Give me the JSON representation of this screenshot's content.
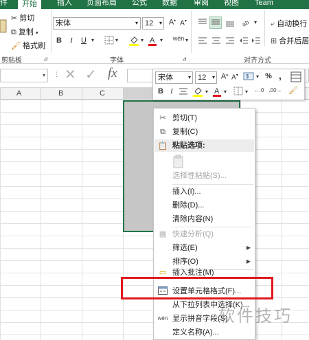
{
  "tabs": [
    {
      "label": "件"
    },
    {
      "label": "开始"
    },
    {
      "label": "插入"
    },
    {
      "label": "页面布局"
    },
    {
      "label": "公式"
    },
    {
      "label": "数据"
    },
    {
      "label": "审阅"
    },
    {
      "label": "视图"
    },
    {
      "label": "Team"
    }
  ],
  "clipboard": {
    "cut": "剪切",
    "copy": "复制",
    "format_painter": "格式刷",
    "group_label": "剪贴板"
  },
  "font": {
    "name": "宋体",
    "size": "12",
    "grow": "A",
    "shrink": "A",
    "bold": "B",
    "italic": "I",
    "underline": "U",
    "group_label": "字体"
  },
  "alignment": {
    "wrap": "自动换行",
    "merge": "合并后居",
    "group_label": "对齐方式"
  },
  "formula_bar": {
    "fx": "fx"
  },
  "columns": [
    "A",
    "B",
    "C"
  ],
  "mini_toolbar": {
    "font": "宋体",
    "size": "12",
    "percent": "%",
    "comma": ","
  },
  "context_menu": {
    "cut": "剪切(T)",
    "copy": "复制(C)",
    "paste_options": "粘贴选项:",
    "paste_special": "选择性粘贴(S)...",
    "insert": "插入(I)...",
    "delete": "删除(D)...",
    "clear": "清除内容(N)",
    "quick_analysis": "快速分析(Q)",
    "filter": "筛选(E)",
    "sort": "排序(O)",
    "insert_comment": "插入批注(M)",
    "format_cells": "设置单元格格式(F)...",
    "pick_list": "从下拉列表中选择(K)...",
    "phonetic": "显示拼音字段(S)",
    "define_name": "定义名称(A)..."
  },
  "watermark": "软件技巧",
  "colors": {
    "accent": "#217346",
    "selection_fill": "#c6c6c6",
    "annotation": "#e0161d"
  }
}
